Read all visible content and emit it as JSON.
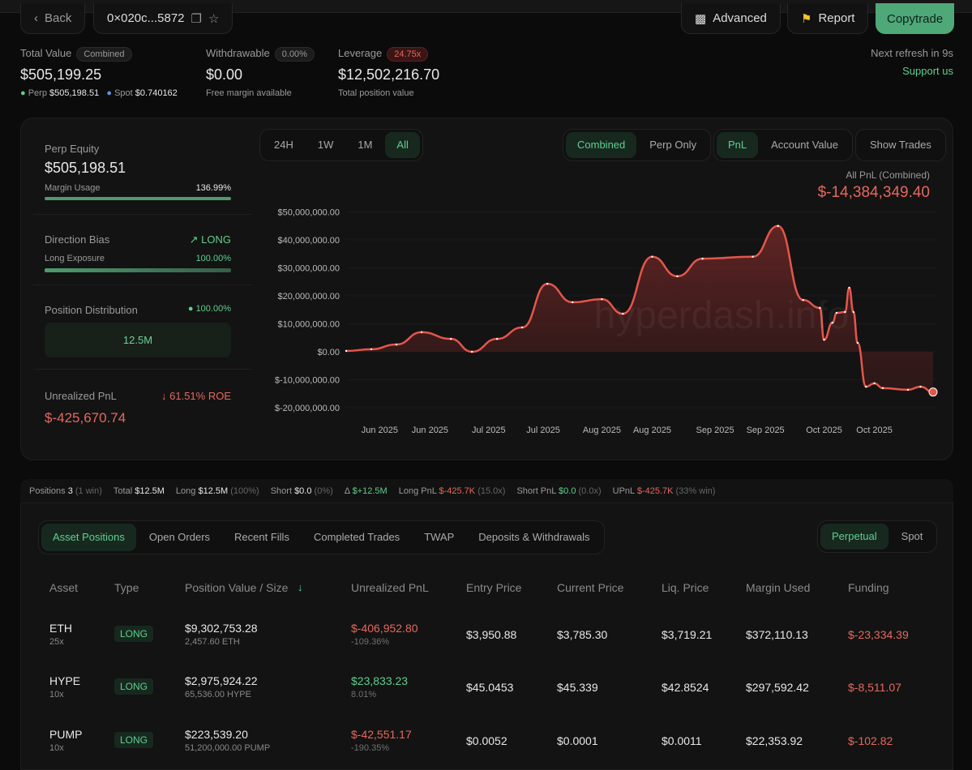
{
  "header": {
    "back": "Back",
    "address": "0×020c...5872",
    "advanced": "Advanced",
    "report": "Report",
    "copytrade": "Copytrade",
    "next_refresh": "Next refresh in 9s",
    "support": "Support us"
  },
  "summary": {
    "total_value": {
      "label": "Total Value",
      "pill": "Combined",
      "value": "$505,199.25",
      "perp_label": "Perp",
      "perp_value": "$505,198.51",
      "spot_label": "Spot",
      "spot_value": "$0.740162"
    },
    "withdrawable": {
      "label": "Withdrawable",
      "pill": "0.00%",
      "value": "$0.00",
      "sub": "Free margin available"
    },
    "leverage": {
      "label": "Leverage",
      "pill": "24.75x",
      "value": "$12,502,216.70",
      "sub": "Total position value"
    }
  },
  "left_panel": {
    "perp_equity_label": "Perp Equity",
    "perp_equity": "$505,198.51",
    "margin_usage_label": "Margin Usage",
    "margin_usage": "136.99%",
    "margin_usage_fill": 1.0,
    "direction_label": "Direction Bias",
    "direction": "LONG",
    "long_exposure_label": "Long Exposure",
    "long_exposure": "100.00%",
    "long_exposure_fill": 1.0,
    "distribution_label": "Position Distribution",
    "distribution_pct": "100.00%",
    "distribution_value": "12.5M",
    "upnl_label": "Unrealized PnL",
    "roe": "61.51% ROE",
    "upnl": "$-425,670.74"
  },
  "controls": {
    "ranges": [
      "24H",
      "1W",
      "1M",
      "All"
    ],
    "range_active": 3,
    "modes": [
      "Combined",
      "Perp Only"
    ],
    "mode_active": 0,
    "metrics": [
      "PnL",
      "Account Value"
    ],
    "metric_active": 0,
    "show_trades": "Show Trades"
  },
  "chart_data": {
    "type": "area",
    "title": "All PnL (Combined)",
    "headline": "$-14,384,349.40",
    "watermark": "hyperdash.info",
    "ylabel": "",
    "xlabel": "",
    "ylim": [
      -20,
      50
    ],
    "y_unit": "millions USD",
    "y_ticks": [
      {
        "v": 50,
        "label": "$50,000,000.00"
      },
      {
        "v": 40,
        "label": "$40,000,000.00"
      },
      {
        "v": 30,
        "label": "$30,000,000.00"
      },
      {
        "v": 20,
        "label": "$20,000,000.00"
      },
      {
        "v": 10,
        "label": "$10,000,000.00"
      },
      {
        "v": 0,
        "label": "$0.00"
      },
      {
        "v": -10,
        "label": "$-10,000,000.00"
      },
      {
        "v": -20,
        "label": "$-20,000,000.00"
      }
    ],
    "x_ticks": [
      {
        "d": 8,
        "label": "Jun 2025"
      },
      {
        "d": 20,
        "label": "Jun 2025"
      },
      {
        "d": 34,
        "label": "Jul 2025"
      },
      {
        "d": 47,
        "label": "Jul 2025"
      },
      {
        "d": 61,
        "label": "Aug 2025"
      },
      {
        "d": 73,
        "label": "Aug 2025"
      },
      {
        "d": 88,
        "label": "Sep 2025"
      },
      {
        "d": 100,
        "label": "Sep 2025"
      },
      {
        "d": 114,
        "label": "Oct 2025"
      },
      {
        "d": 126,
        "label": "Oct 2025"
      }
    ],
    "x": [
      0,
      6,
      12,
      18,
      25,
      30,
      36,
      42,
      48,
      54,
      61,
      66,
      73,
      79,
      85,
      97,
      103,
      109,
      113,
      114,
      116,
      117,
      119,
      120,
      121,
      122,
      124,
      126,
      128,
      134,
      137,
      140
    ],
    "values": [
      0.3,
      0.9,
      2.6,
      7,
      4.6,
      0,
      4.6,
      8.7,
      24.3,
      17.7,
      18.8,
      13.6,
      34,
      27,
      33.3,
      34,
      45,
      18.5,
      15.7,
      4.3,
      10.4,
      13.9,
      14.2,
      22.9,
      14.2,
      3.2,
      -12.5,
      -11.3,
      -13,
      -13.6,
      -12.5,
      -14.4
    ],
    "line_color": "#e5564b"
  },
  "stats": [
    {
      "label": "Positions",
      "value": "3",
      "extra": "(1 win)",
      "cls": ""
    },
    {
      "label": "Total",
      "value": "$12.5M",
      "extra": "",
      "cls": ""
    },
    {
      "label": "Long",
      "value": "$12.5M",
      "extra": "(100%)",
      "cls": ""
    },
    {
      "label": "Short",
      "value": "$0.0",
      "extra": "(0%)",
      "cls": ""
    },
    {
      "label": "Δ",
      "value": "$+12.5M",
      "extra": "",
      "cls": "green"
    },
    {
      "label": "Long PnL",
      "value": "$-425.7K",
      "extra": "(15.0x)",
      "cls": "red"
    },
    {
      "label": "Short PnL",
      "value": "$0.0",
      "extra": "(0.0x)",
      "cls": "green"
    },
    {
      "label": "UPnL",
      "value": "$-425.7K",
      "extra": "(33% win)",
      "cls": "red"
    }
  ],
  "tabs": [
    "Asset Positions",
    "Open Orders",
    "Recent Fills",
    "Completed Trades",
    "TWAP",
    "Deposits & Withdrawals"
  ],
  "tab_active": 0,
  "market_tabs": [
    "Perpetual",
    "Spot"
  ],
  "market_active": 0,
  "table": {
    "columns": [
      "Asset",
      "Type",
      "Position Value / Size",
      "Unrealized PnL",
      "Entry Price",
      "Current Price",
      "Liq. Price",
      "Margin Used",
      "Funding"
    ],
    "rows": [
      {
        "asset": "ETH",
        "lev": "25x",
        "type": "LONG",
        "value": "$9,302,753.28",
        "size": "2,457.60 ETH",
        "pnl": "$-406,952.80",
        "pnl_pct": "-109.36%",
        "pnl_pos": false,
        "entry": "$3,950.88",
        "current": "$3,785.30",
        "liq": "$3,719.21",
        "margin": "$372,110.13",
        "funding": "$-23,334.39"
      },
      {
        "asset": "HYPE",
        "lev": "10x",
        "type": "LONG",
        "value": "$2,975,924.22",
        "size": "65,536.00 HYPE",
        "pnl": "$23,833.23",
        "pnl_pct": "8.01%",
        "pnl_pos": true,
        "entry": "$45.0453",
        "current": "$45.339",
        "liq": "$42.8524",
        "margin": "$297,592.42",
        "funding": "$-8,511.07"
      },
      {
        "asset": "PUMP",
        "lev": "10x",
        "type": "LONG",
        "value": "$223,539.20",
        "size": "51,200,000.00 PUMP",
        "pnl": "$-42,551.17",
        "pnl_pct": "-190.35%",
        "pnl_pos": false,
        "entry": "$0.0052",
        "current": "$0.0001",
        "liq": "$0.0011",
        "margin": "$22,353.92",
        "funding": "$-102.82"
      }
    ]
  }
}
